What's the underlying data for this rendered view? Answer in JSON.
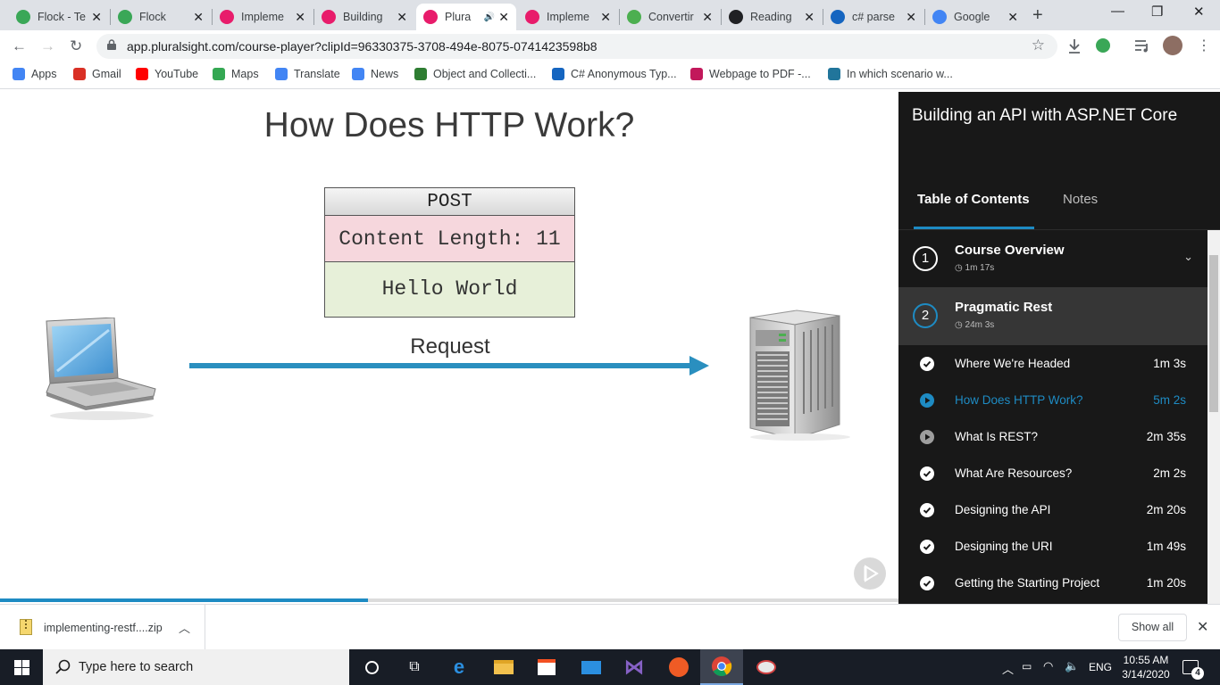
{
  "browser": {
    "tabs": [
      {
        "title": "Flock - Te",
        "icon": "flock-icon",
        "color": "#3aa757"
      },
      {
        "title": "Flock",
        "icon": "flock-icon",
        "color": "#3aa757"
      },
      {
        "title": "Impleme",
        "icon": "pluralsight-icon",
        "color": "#e81c6b"
      },
      {
        "title": "Building",
        "icon": "pluralsight-icon",
        "color": "#e81c6b"
      },
      {
        "title": "Plura",
        "icon": "pluralsight-icon",
        "color": "#e81c6b",
        "active": true,
        "audio": true
      },
      {
        "title": "Impleme",
        "icon": "pluralsight-icon",
        "color": "#e81c6b"
      },
      {
        "title": "Convertir",
        "icon": "convert-icon",
        "color": "#4caf50"
      },
      {
        "title": "Reading",
        "icon": "graduation-cap-icon",
        "color": "#202124"
      },
      {
        "title": "c# parse",
        "icon": "pen-icon",
        "color": "#1565c0"
      },
      {
        "title": "Google",
        "icon": "google-translate-icon",
        "color": "#4285f4"
      }
    ],
    "url": "app.pluralsight.com/course-player?clipId=96330375-3708-494e-8075-0741423598b8",
    "bookmarks": [
      {
        "label": "Apps",
        "icon": "apps-grid-icon"
      },
      {
        "label": "Gmail",
        "icon": "gmail-icon"
      },
      {
        "label": "YouTube",
        "icon": "youtube-icon"
      },
      {
        "label": "Maps",
        "icon": "maps-icon"
      },
      {
        "label": "Translate",
        "icon": "translate-icon"
      },
      {
        "label": "News",
        "icon": "news-icon"
      },
      {
        "label": "Object and Collecti...",
        "icon": "dg-icon"
      },
      {
        "label": "C# Anonymous Typ...",
        "icon": "t-icon"
      },
      {
        "label": "Webpage to PDF -...",
        "icon": "w-icon"
      },
      {
        "label": "In which scenario w...",
        "icon": "wordpress-icon"
      }
    ]
  },
  "slide": {
    "title": "How Does HTTP Work?",
    "packet": {
      "method": "POST",
      "header": "Content Length: 11",
      "body": "Hello World"
    },
    "request_label": "Request",
    "progress": 0.41
  },
  "sidebar": {
    "course_title": "Building an API with ASP.NET Core",
    "tabs": [
      {
        "label": "Table of Contents",
        "active": true
      },
      {
        "label": "Notes",
        "active": false
      }
    ],
    "modules": [
      {
        "number": "1",
        "title": "Course Overview",
        "duration": "1m 17s"
      },
      {
        "number": "2",
        "title": "Pragmatic Rest",
        "duration": "24m 3s"
      }
    ],
    "clips": [
      {
        "title": "Where We're Headed",
        "duration": "1m 3s",
        "status": "watched"
      },
      {
        "title": "How Does HTTP Work?",
        "duration": "5m 2s",
        "status": "current"
      },
      {
        "title": "What Is REST?",
        "duration": "2m 35s",
        "status": "unwatched"
      },
      {
        "title": "What Are Resources?",
        "duration": "2m 2s",
        "status": "watched"
      },
      {
        "title": "Designing the API",
        "duration": "2m 20s",
        "status": "watched"
      },
      {
        "title": "Designing the URI",
        "duration": "1m 49s",
        "status": "watched"
      },
      {
        "title": "Getting the Starting Project",
        "duration": "1m 20s",
        "status": "watched"
      }
    ]
  },
  "downloads": {
    "file": "implementing-restf....zip",
    "show_all": "Show all"
  },
  "taskbar": {
    "search_placeholder": "Type here to search",
    "language": "ENG",
    "time": "10:55 AM",
    "date": "3/14/2020",
    "notifications": "4"
  },
  "colors": {
    "accent": "#1e8bc3",
    "sidebar_bg": "#181818",
    "current_module_bg": "#363636"
  }
}
